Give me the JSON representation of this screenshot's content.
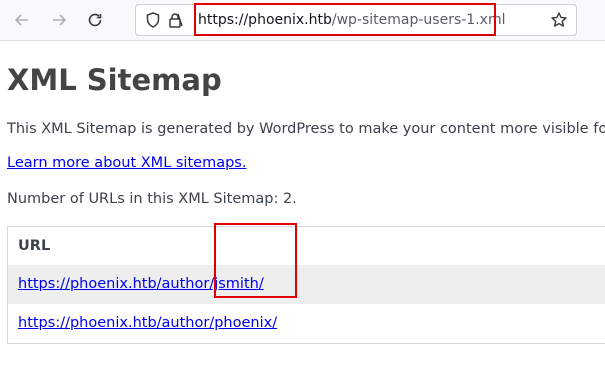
{
  "browser": {
    "url_host": "https://phoenix.htb",
    "url_path": "/wp-sitemap-users-1.xml",
    "highlight_color": "#e00000"
  },
  "page": {
    "title": "XML Sitemap",
    "description": "This XML Sitemap is generated by WordPress to make your content more visible for",
    "learn_more_link": "Learn more about XML sitemaps.",
    "url_count_text": "Number of URLs in this XML Sitemap: 2."
  },
  "table": {
    "header": "URL",
    "rows": [
      {
        "url": "https://phoenix.htb/author/jsmith/"
      },
      {
        "url": "https://phoenix.htb/author/phoenix/"
      }
    ]
  },
  "icons": [
    "back-arrow-icon",
    "forward-arrow-icon",
    "reload-icon",
    "shield-icon",
    "lock-icon",
    "star-icon"
  ]
}
